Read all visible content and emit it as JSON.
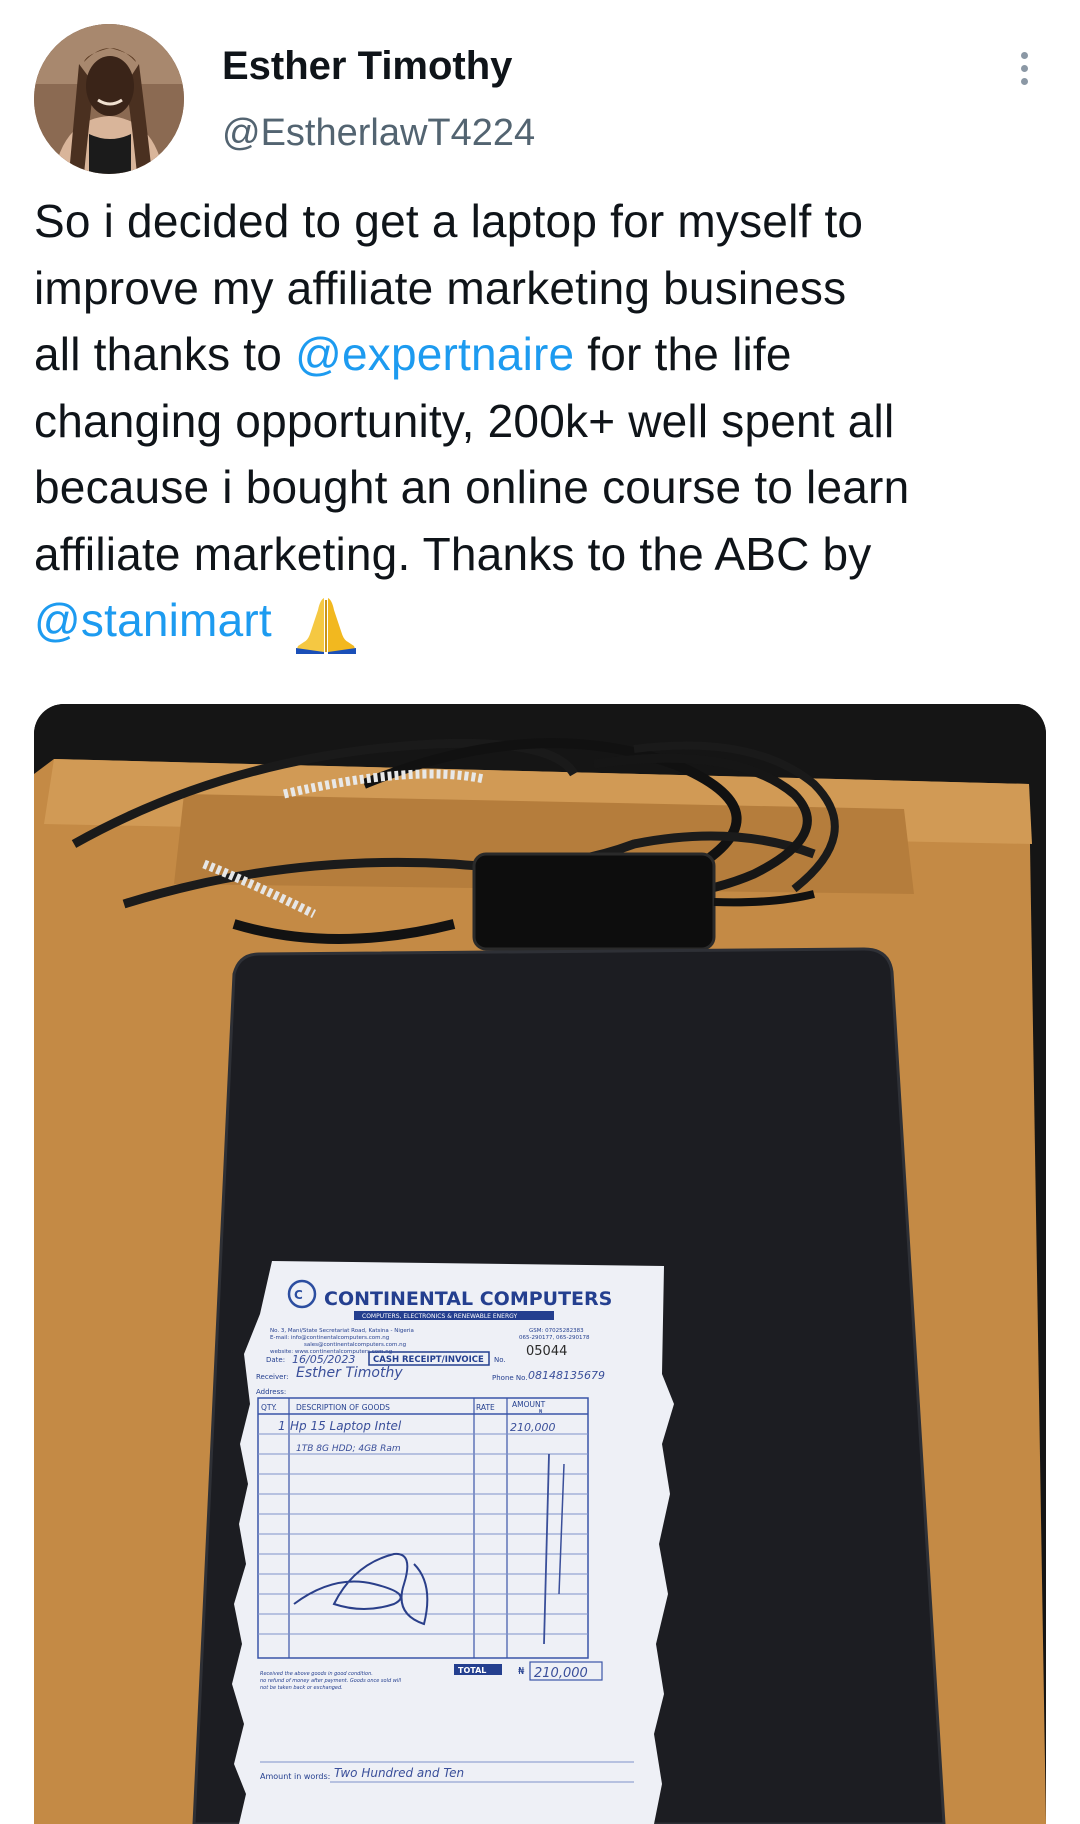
{
  "user": {
    "display_name": "Esther Timothy",
    "handle": "@EstherlawT4224"
  },
  "tweet": {
    "line1": "So i decided to get a laptop for myself to",
    "line2": "improve my affiliate marketing business",
    "line3_before": "all thanks to ",
    "line3_mention": "@expertnaire",
    "line3_after": " for the life",
    "line4": "changing opportunity, 200k+ well spent all",
    "line5": "because i bought an online course to learn",
    "line6": "affiliate marketing. Thanks to the ABC by",
    "line7_mention": "@stanimart",
    "emoji_icon": "folded-hands-icon"
  },
  "receipt": {
    "company": "CONTINENTAL COMPUTERS",
    "tagline": "COMPUTERS, ELECTRONICS & RENEWABLE ENERGY",
    "address": "No. 3, Mani/State Secretariat Road, Katsina - Nigeria",
    "email": "E-mail: info@continentalcomputers.com.ng",
    "email2": "sales@continentalcomputers.com.ng",
    "website": "website: www.continentalcomputers.com.ng",
    "gsm": "GSM: 07025282383",
    "gsm2": "065-290177, 065-290178",
    "date_label": "Date:",
    "date_value": "16/05/2023",
    "doc_type": "CASH RECEIPT/INVOICE",
    "no_label": "No.",
    "number": "05044",
    "receiver_label": "Receiver:",
    "receiver": "Esther Timothy",
    "phone_label": "Phone No.",
    "phone": "08148135679",
    "address_label": "Address:",
    "col_qty": "QTY.",
    "col_desc": "DESCRIPTION OF GOODS",
    "col_rate": "RATE",
    "col_amount": "AMOUNT",
    "currency": "₦",
    "row1_qty": "1",
    "row1_desc": "Hp 15 Laptop Intel",
    "row1_amount": "210,000",
    "row2_desc": "1TB 8G HDD; 4GB Ram",
    "terms1": "Received the above goods in good condition.",
    "terms2": "no refund of money after payment. Goods once sold will",
    "terms3": "not be taken back or exchanged.",
    "total_label": "TOTAL",
    "total_value": "210,000",
    "amount_words_label": "Amount in words:",
    "amount_words": "Two Hundred and Ten"
  }
}
